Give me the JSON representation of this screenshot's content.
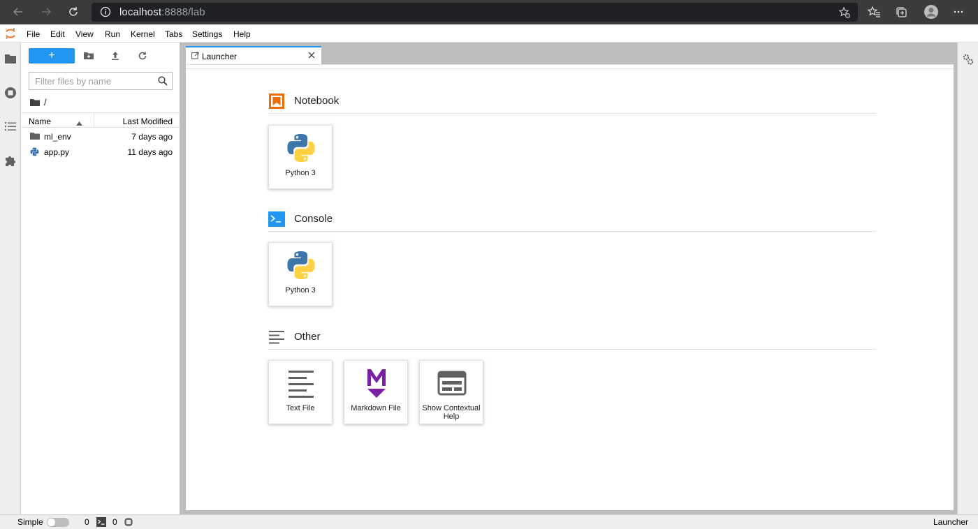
{
  "browser": {
    "url_host": "localhost",
    "url_rest": ":8888/lab"
  },
  "menu": {
    "items": [
      "File",
      "Edit",
      "View",
      "Run",
      "Kernel",
      "Tabs",
      "Settings",
      "Help"
    ]
  },
  "filebrowser": {
    "new_label": "+",
    "filter_placeholder": "Filter files by name",
    "breadcrumb": "/",
    "col_name": "Name",
    "col_modified": "Last Modified",
    "files": [
      {
        "name": "ml_env",
        "modified": "7 days ago",
        "icon": "folder-icon"
      },
      {
        "name": "app.py",
        "modified": "11 days ago",
        "icon": "python-file-icon"
      }
    ]
  },
  "launcher": {
    "tab_label": "Launcher",
    "sections": [
      {
        "title": "Notebook",
        "icon": "notebook-icon",
        "cards": [
          {
            "label": "Python 3",
            "icon": "python-logo-icon"
          }
        ]
      },
      {
        "title": "Console",
        "icon": "console-icon",
        "cards": [
          {
            "label": "Python 3",
            "icon": "python-logo-icon"
          }
        ]
      },
      {
        "title": "Other",
        "icon": "other-icon",
        "cards": [
          {
            "label": "Text File",
            "icon": "text-file-icon"
          },
          {
            "label": "Markdown File",
            "icon": "markdown-icon"
          },
          {
            "label": "Show Contextual Help",
            "icon": "contextual-help-icon"
          }
        ]
      }
    ]
  },
  "statusbar": {
    "mode_label": "Simple",
    "kernels_count": "0",
    "terminals_count": "0",
    "right_label": "Launcher"
  },
  "colors": {
    "accent": "#2196f3",
    "notebook": "#ef6c00",
    "markdown": "#7b1fa2"
  }
}
